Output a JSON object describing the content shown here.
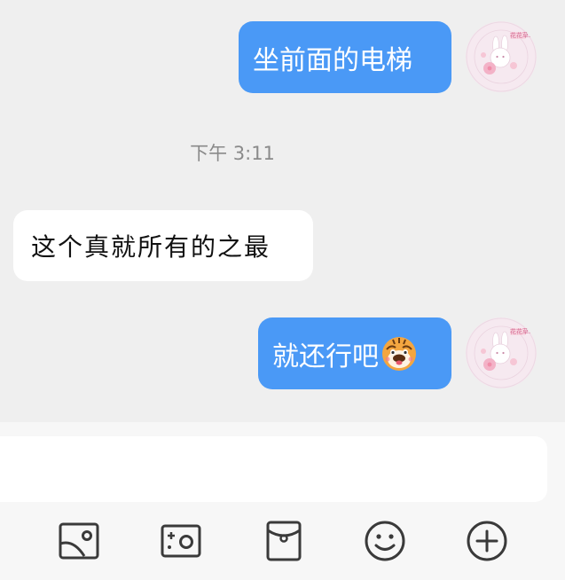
{
  "messages": [
    {
      "direction": "out",
      "text": "坐前面的电梯"
    },
    {
      "direction": "in",
      "text": "这个真就所有的之最"
    },
    {
      "direction": "out",
      "text": "就还行吧",
      "sticker": "tiger-emoji"
    }
  ],
  "timestamp": "下午 3:11",
  "avatar": {
    "badge_text": "花花草草"
  },
  "input": {
    "placeholder": "",
    "value": ""
  },
  "toolbar": {
    "icons": [
      "image-icon",
      "camera-icon",
      "red-packet-icon",
      "emoji-icon",
      "add-icon"
    ]
  },
  "colors": {
    "outgoing_bubble": "#4a99f6",
    "incoming_bubble": "#ffffff",
    "background": "#efefef",
    "icon_stroke": "#3a3a3a"
  }
}
